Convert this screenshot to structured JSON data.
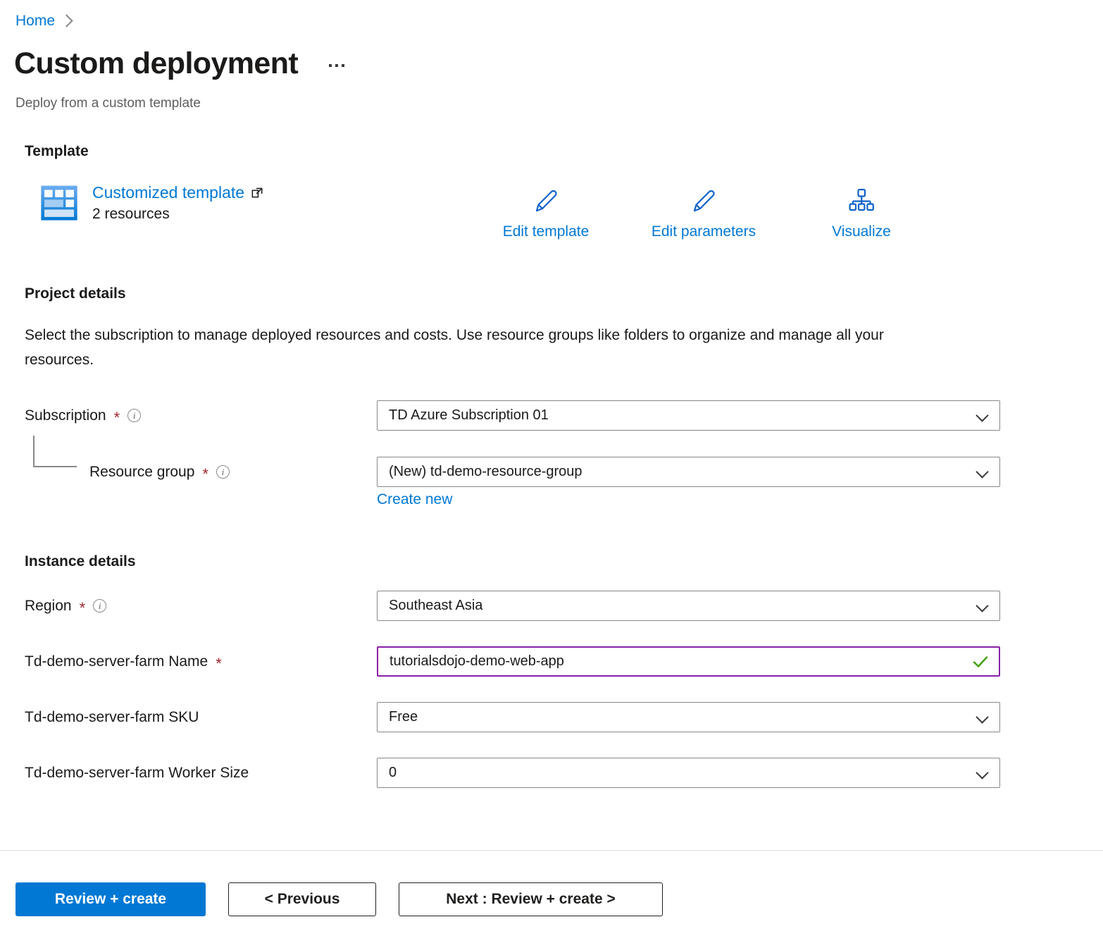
{
  "breadcrumb": {
    "home_label": "Home",
    "separator_icon": "chevron-right-icon"
  },
  "header": {
    "title": "Custom deployment",
    "subtitle": "Deploy from a custom template",
    "more_menu_icon": "ellipsis-icon"
  },
  "template_section": {
    "heading": "Template",
    "icon": "template-grid-icon",
    "link_label": "Customized template",
    "external_link_icon": "external-link-icon",
    "resource_count": "2 resources",
    "actions": [
      {
        "label": "Edit template",
        "icon": "pencil-icon"
      },
      {
        "label": "Edit parameters",
        "icon": "pencil-icon"
      },
      {
        "label": "Visualize",
        "icon": "hierarchy-icon"
      }
    ]
  },
  "project_details": {
    "heading": "Project details",
    "description": "Select the subscription to manage deployed resources and costs. Use resource groups like folders to organize and manage all your resources.",
    "fields": [
      {
        "label": "Subscription",
        "required": true,
        "required_marker": "*",
        "info_icon": "info-icon",
        "type": "dropdown",
        "value": "TD Azure Subscription 01",
        "dropdown_icon": "chevron-down-icon"
      },
      {
        "label": "Resource group",
        "required": true,
        "required_marker": "*",
        "info_icon": "info-icon",
        "type": "dropdown",
        "value": "(New) td-demo-resource-group",
        "dropdown_icon": "chevron-down-icon",
        "sublink": "Create new"
      }
    ]
  },
  "instance_details": {
    "heading": "Instance details",
    "fields": [
      {
        "label": "Region",
        "required": true,
        "required_marker": "*",
        "info_icon": "info-icon",
        "type": "dropdown",
        "value": "Southeast Asia",
        "dropdown_icon": "chevron-down-icon"
      },
      {
        "label": "Td-demo-server-farm Name",
        "required": true,
        "required_marker": "*",
        "type": "text",
        "value": "tutorialsdojo-demo-web-app",
        "validation_icon": "checkmark-icon",
        "focused": true
      },
      {
        "label": "Td-demo-server-farm SKU",
        "required": false,
        "type": "dropdown",
        "value": "Free",
        "dropdown_icon": "chevron-down-icon"
      },
      {
        "label": "Td-demo-server-farm Worker Size",
        "required": false,
        "type": "dropdown",
        "value": "0",
        "dropdown_icon": "chevron-down-icon"
      }
    ]
  },
  "footer": {
    "review_create_label": "Review + create",
    "previous_label": "< Previous",
    "next_label": "Next : Review + create >"
  },
  "colors": {
    "accent_blue": "#0078d4",
    "link_blue": "#0078d4",
    "required_red": "#a4262c",
    "focus_purple": "#8a1fa8",
    "valid_green": "#3d9e00",
    "border_gray": "#8a8886",
    "text_dark": "#1b1a19",
    "text_muted": "#605e5c"
  }
}
